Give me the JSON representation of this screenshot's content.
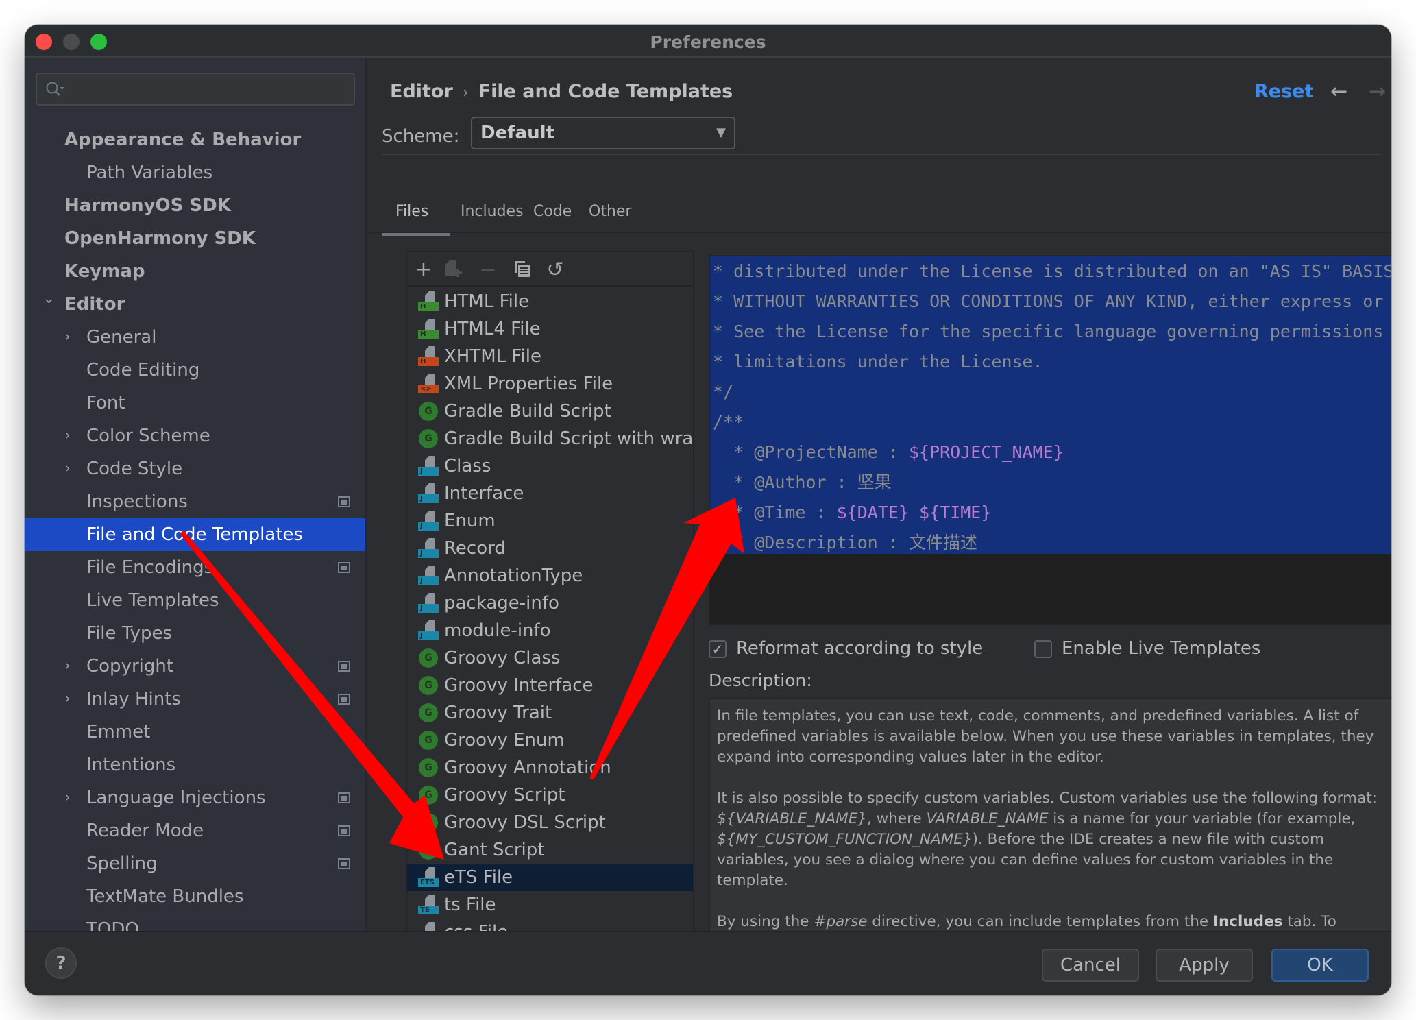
{
  "window": {
    "title": "Preferences"
  },
  "sidebar": {
    "search_placeholder": "",
    "items": [
      {
        "label": "Appearance & Behavior",
        "level": 0,
        "expandable": false,
        "project_icon": false
      },
      {
        "label": "Path Variables",
        "level": 1,
        "expandable": false,
        "project_icon": false
      },
      {
        "label": "HarmonyOS SDK",
        "level": 0,
        "expandable": false,
        "project_icon": false
      },
      {
        "label": "OpenHarmony SDK",
        "level": 0,
        "expandable": false,
        "project_icon": false
      },
      {
        "label": "Keymap",
        "level": 0,
        "expandable": false,
        "project_icon": false
      },
      {
        "label": "Editor",
        "level": 0,
        "expandable": true,
        "expanded": true,
        "project_icon": false
      },
      {
        "label": "General",
        "level": 1,
        "expandable": true,
        "project_icon": false
      },
      {
        "label": "Code Editing",
        "level": 1,
        "expandable": false,
        "project_icon": false
      },
      {
        "label": "Font",
        "level": 1,
        "expandable": false,
        "project_icon": false
      },
      {
        "label": "Color Scheme",
        "level": 1,
        "expandable": true,
        "project_icon": false
      },
      {
        "label": "Code Style",
        "level": 1,
        "expandable": true,
        "project_icon": false
      },
      {
        "label": "Inspections",
        "level": 1,
        "expandable": false,
        "project_icon": true
      },
      {
        "label": "File and Code Templates",
        "level": 1,
        "expandable": false,
        "project_icon": false,
        "selected": true
      },
      {
        "label": "File Encodings",
        "level": 1,
        "expandable": false,
        "project_icon": true
      },
      {
        "label": "Live Templates",
        "level": 1,
        "expandable": false,
        "project_icon": false
      },
      {
        "label": "File Types",
        "level": 1,
        "expandable": false,
        "project_icon": false
      },
      {
        "label": "Copyright",
        "level": 1,
        "expandable": true,
        "project_icon": true
      },
      {
        "label": "Inlay Hints",
        "level": 1,
        "expandable": true,
        "project_icon": true
      },
      {
        "label": "Emmet",
        "level": 1,
        "expandable": false,
        "project_icon": false
      },
      {
        "label": "Intentions",
        "level": 1,
        "expandable": false,
        "project_icon": false
      },
      {
        "label": "Language Injections",
        "level": 1,
        "expandable": true,
        "project_icon": true
      },
      {
        "label": "Reader Mode",
        "level": 1,
        "expandable": false,
        "project_icon": true
      },
      {
        "label": "Spelling",
        "level": 1,
        "expandable": false,
        "project_icon": true
      },
      {
        "label": "TextMate Bundles",
        "level": 1,
        "expandable": false,
        "project_icon": false
      },
      {
        "label": "TODO",
        "level": 1,
        "expandable": false,
        "project_icon": false
      }
    ]
  },
  "header": {
    "breadcrumb": [
      "Editor",
      "File and Code Templates"
    ],
    "breadcrumb_separator": "›",
    "reset_label": "Reset",
    "back_icon": "←",
    "forward_icon": "→"
  },
  "scheme": {
    "label": "Scheme:",
    "value": "Default"
  },
  "tabs": [
    {
      "label": "Files",
      "active": true
    },
    {
      "label": "Includes",
      "active": false
    },
    {
      "label": "Code",
      "active": false
    },
    {
      "label": "Other",
      "active": false
    }
  ],
  "toolbar": {
    "add": "+",
    "remove": "−",
    "reset": "↺"
  },
  "templates": [
    {
      "label": "HTML File",
      "icon": "file",
      "badge": "H",
      "badge_color": "#3a8a2e"
    },
    {
      "label": "HTML4 File",
      "icon": "file",
      "badge": "H",
      "badge_color": "#3a8a2e"
    },
    {
      "label": "XHTML File",
      "icon": "file",
      "badge": "H",
      "badge_color": "#c4471a"
    },
    {
      "label": "XML Properties File",
      "icon": "file",
      "badge": "<>",
      "badge_color": "#c4471a"
    },
    {
      "label": "Gradle Build Script",
      "icon": "groovy",
      "badge": "G"
    },
    {
      "label": "Gradle Build Script with wrap",
      "icon": "groovy",
      "badge": "G"
    },
    {
      "label": "Class",
      "icon": "file",
      "badge": "J",
      "badge_color": "#1a86a8"
    },
    {
      "label": "Interface",
      "icon": "file",
      "badge": "J",
      "badge_color": "#1a86a8"
    },
    {
      "label": "Enum",
      "icon": "file",
      "badge": "J",
      "badge_color": "#1a86a8"
    },
    {
      "label": "Record",
      "icon": "file",
      "badge": "J",
      "badge_color": "#1a86a8"
    },
    {
      "label": "AnnotationType",
      "icon": "file",
      "badge": "J",
      "badge_color": "#1a86a8"
    },
    {
      "label": "package-info",
      "icon": "file",
      "badge": "J",
      "badge_color": "#1a86a8"
    },
    {
      "label": "module-info",
      "icon": "file",
      "badge": "J",
      "badge_color": "#1a86a8"
    },
    {
      "label": "Groovy Class",
      "icon": "groovy",
      "badge": "G"
    },
    {
      "label": "Groovy Interface",
      "icon": "groovy",
      "badge": "G"
    },
    {
      "label": "Groovy Trait",
      "icon": "groovy",
      "badge": "G"
    },
    {
      "label": "Groovy Enum",
      "icon": "groovy",
      "badge": "G"
    },
    {
      "label": "Groovy Annotation",
      "icon": "groovy",
      "badge": "G"
    },
    {
      "label": "Groovy Script",
      "icon": "groovy",
      "badge": "G"
    },
    {
      "label": "Groovy DSL Script",
      "icon": "groovy",
      "badge": "G"
    },
    {
      "label": "Gant Script",
      "icon": "groovy",
      "badge": "G"
    },
    {
      "label": "eTS File",
      "icon": "file",
      "badge": "ETS",
      "badge_color": "#1a86a8",
      "selected": true
    },
    {
      "label": "ts File",
      "icon": "file",
      "badge": "TS",
      "badge_color": "#1a86a8"
    },
    {
      "label": "css File",
      "icon": "file",
      "badge": "CSS",
      "badge_color": "#1a86a8"
    }
  ],
  "editor": {
    "lines": [
      {
        "indent": "",
        "text": "* distributed under the License is distributed on an \"AS IS\" BASIS,",
        "var": ""
      },
      {
        "indent": "",
        "text": "* WITHOUT WARRANTIES OR CONDITIONS OF ANY KIND, either express or implied.",
        "var": ""
      },
      {
        "indent": "",
        "text": "* See the License for the specific language governing permissions and",
        "var": ""
      },
      {
        "indent": "",
        "text": "* limitations under the License.",
        "var": ""
      },
      {
        "indent": "",
        "text": "*/",
        "var": ""
      },
      {
        "indent": "",
        "text": "/**",
        "var": ""
      },
      {
        "indent": "  ",
        "text": "* @ProjectName : ",
        "var": "${PROJECT_NAME}"
      },
      {
        "indent": "  ",
        "text": "* @Author : 坚果",
        "var": ""
      },
      {
        "indent": "  ",
        "text": "* @Time : ",
        "var": "${DATE} ${TIME}"
      },
      {
        "indent": "  ",
        "text": "* @Description : 文件描述",
        "var": ""
      }
    ]
  },
  "options": {
    "reformat": {
      "label": "Reformat according to style",
      "checked": true
    },
    "live_templates": {
      "label": "Enable Live Templates",
      "checked": false
    }
  },
  "description": {
    "label": "Description:",
    "p1": "In file templates, you can use text, code, comments, and predefined variables. A list of predefined variables is available below. When you use these variables in templates, they expand into corresponding values later in the editor.",
    "p2_a": "It is also possible to specify custom variables. Custom variables use the following format: ",
    "p2_var1": "${VARIABLE_NAME}",
    "p2_b": ", where ",
    "p2_var2": "VARIABLE_NAME",
    "p2_c": " is a name for your variable (for example, ",
    "p2_var3": "${MY_CUSTOM_FUNCTION_NAME}",
    "p2_d": "). Before the IDE creates a new file with custom variables, you see a dialog where you can define values for custom variables in the template.",
    "p3_a": "By using the ",
    "p3_parse": "#parse",
    "p3_b": " directive, you can include templates from the ",
    "p3_includes": "Includes",
    "p3_c": " tab. To include a template, specify the full name of the template as a parameter in quotation marks."
  },
  "footer": {
    "help": "?",
    "cancel": "Cancel",
    "apply": "Apply",
    "ok": "OK"
  },
  "annotations": {
    "arrow_color": "#ff0000"
  }
}
